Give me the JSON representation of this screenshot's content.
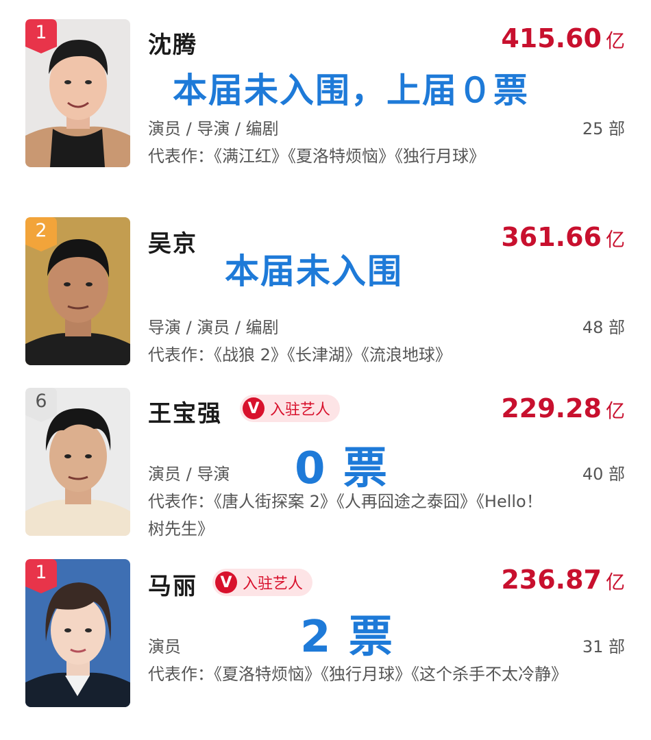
{
  "colors": {
    "box_office": "#c8102e",
    "overlay": "#1e7ad8",
    "rank_red": "#e8344a",
    "rank_orange": "#f2a43a",
    "rank_gray": "#e5e5e5",
    "verified": "#d8112c"
  },
  "entries": [
    {
      "rank": "1",
      "rank_style": "red",
      "name": "沈腾",
      "box_office": "415.60",
      "unit": "亿",
      "roles": "演员 / 导演 / 编剧",
      "count": "25 部",
      "works": "代表作：《满江红》《夏洛特烦恼》《独行月球》",
      "overlay": "本届未入围，上届０票",
      "verified": null
    },
    {
      "rank": "2",
      "rank_style": "orange",
      "name": "吴京",
      "box_office": "361.66",
      "unit": "亿",
      "roles": "导演 / 演员 / 编剧",
      "count": "48 部",
      "works": "代表作：《战狼 2》《长津湖》《流浪地球》",
      "overlay": "本届未入围",
      "verified": null
    },
    {
      "rank": "6",
      "rank_style": "gray",
      "name": "王宝强",
      "box_office": "229.28",
      "unit": "亿",
      "roles": "演员 / 导演",
      "count": "40 部",
      "works": "代表作：《唐人街探案 2》《人再囧途之泰囧》《Hello！ 树先生》",
      "overlay": "0 票",
      "verified": "入驻艺人"
    },
    {
      "rank": "1",
      "rank_style": "red",
      "name": "马丽",
      "box_office": "236.87",
      "unit": "亿",
      "roles": "演员",
      "count": "31 部",
      "works": "代表作：《夏洛特烦恼》《独行月球》《这个杀手不太冷静》",
      "overlay": "2 票",
      "verified": "入驻艺人"
    }
  ],
  "icons": {
    "rank_badge": "ribbon-badge-icon",
    "verified_badge": "v-verified-icon"
  }
}
